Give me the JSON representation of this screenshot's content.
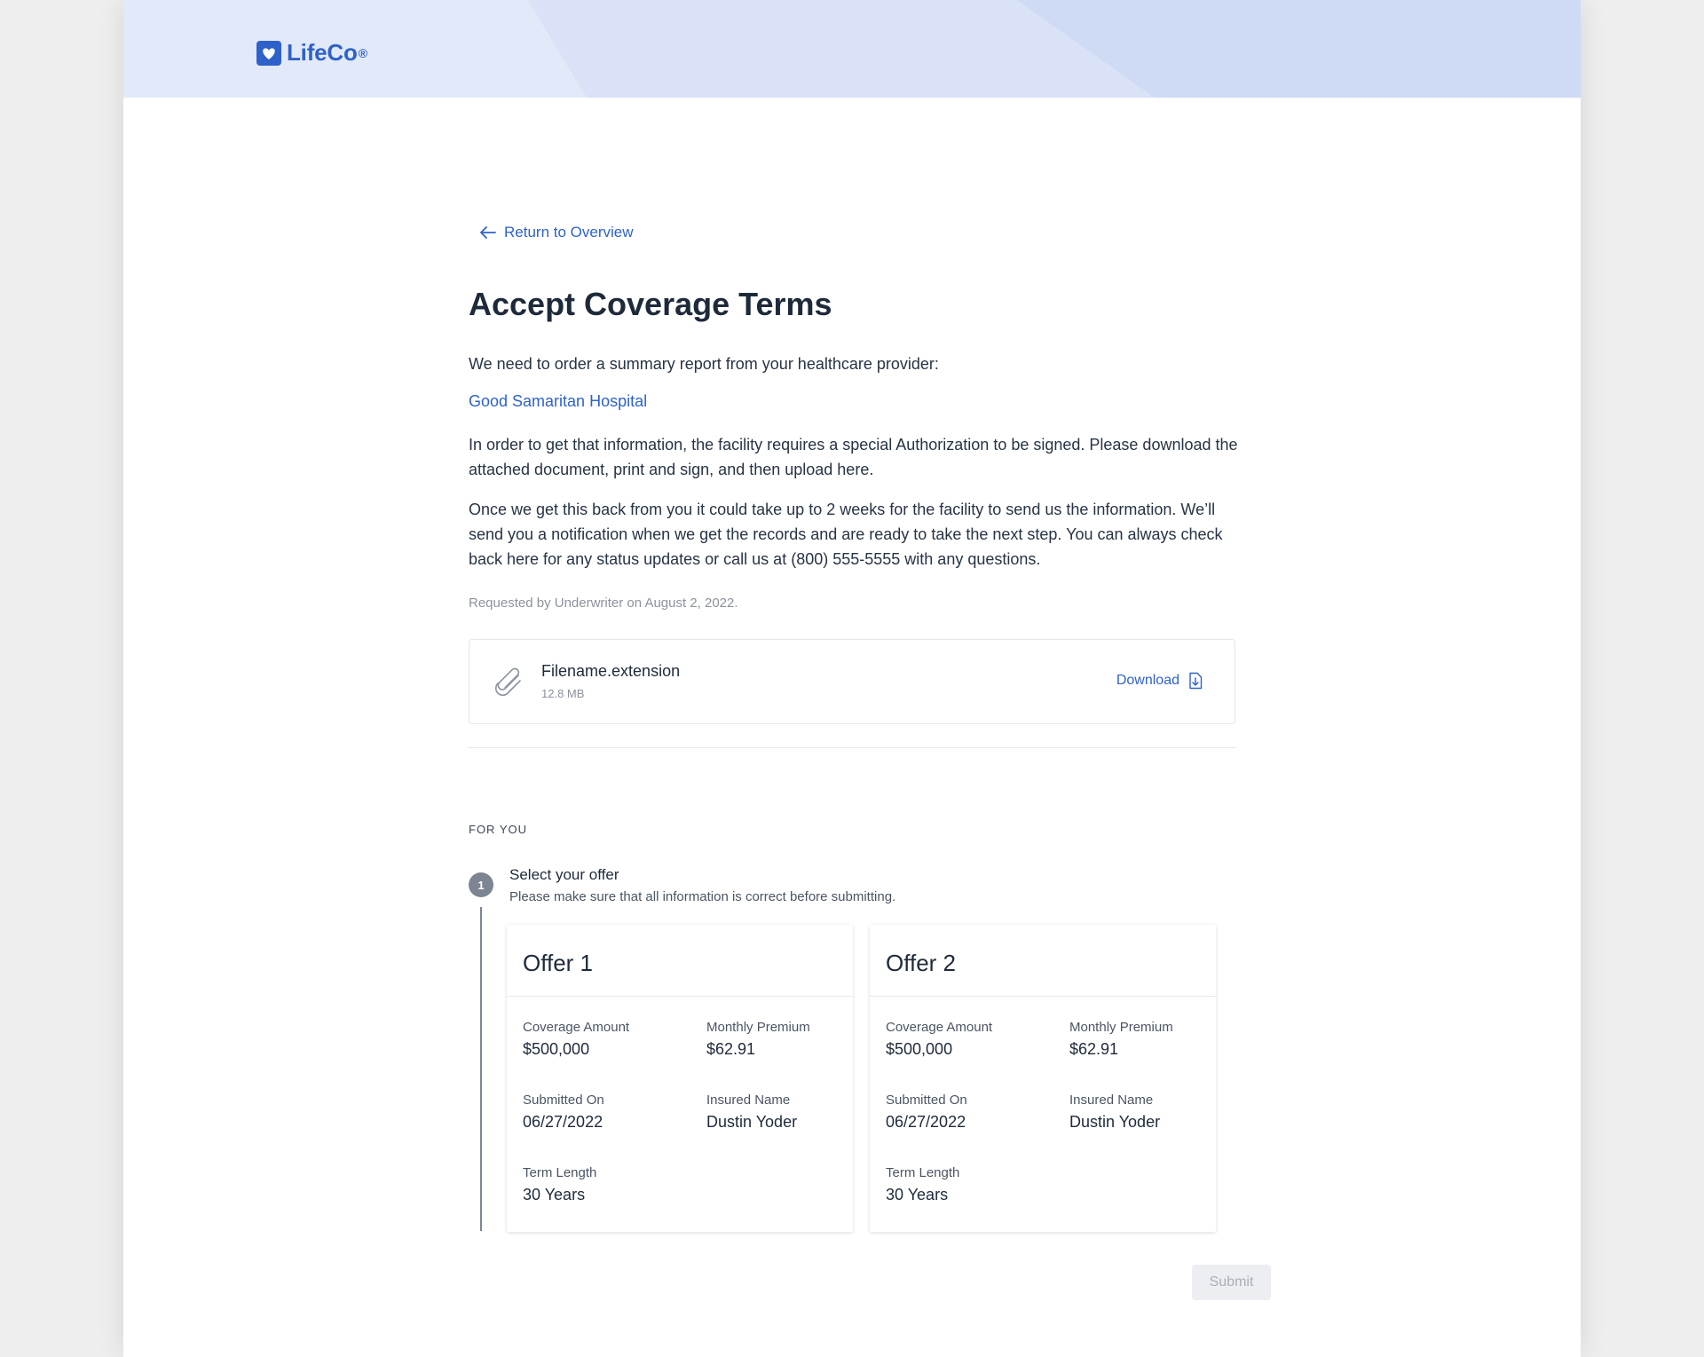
{
  "brand": {
    "name": "LifeCo",
    "registered_mark": "®",
    "color": "#2f62c9"
  },
  "nav": {
    "back_label": "Return to Overview"
  },
  "page": {
    "title": "Accept Coverage Terms",
    "intro": "We need to order a summary report from your healthcare provider:",
    "provider_name": "Good Samaritan Hospital",
    "authorization_text": "In order to get that information, the facility requires a special Authorization to be signed. Please download the attached document, print and sign, and then upload here.",
    "timeline_text": "Once we get this back from you it could take up to 2 weeks for the facility to send us the information. We’ll send you a notification when we get the records and are ready to take the next step. You can always check back here for any status updates or call us at (800) 555-5555 with any questions.",
    "requested_text": "Requested by Underwriter on August 2, 2022."
  },
  "attachment": {
    "filename": "Filename.extension",
    "size": "12.8 MB",
    "download_label": "Download"
  },
  "for_you": {
    "section_label": "FOR YOU",
    "step": {
      "number": "1",
      "title": "Select your offer",
      "subtitle": "Please make sure that all information is correct before submitting."
    },
    "offers": [
      {
        "title": "Offer 1",
        "coverage_label": "Coverage Amount",
        "coverage_value": "$500,000",
        "premium_label": "Monthly Premium",
        "premium_value": "$62.91",
        "submitted_label": "Submitted On",
        "submitted_value": "06/27/2022",
        "insured_label": "Insured Name",
        "insured_value": "Dustin Yoder",
        "term_label": "Term Length",
        "term_value": "30 Years"
      },
      {
        "title": "Offer 2",
        "coverage_label": "Coverage Amount",
        "coverage_value": "$500,000",
        "premium_label": "Monthly Premium",
        "premium_value": "$62.91",
        "submitted_label": "Submitted On",
        "submitted_value": "06/27/2022",
        "insured_label": "Insured Name",
        "insured_value": "Dustin Yoder",
        "term_label": "Term Length",
        "term_value": "30 Years"
      }
    ]
  },
  "actions": {
    "submit_label": "Submit"
  },
  "icons": {
    "logo": "heart-badge-icon",
    "back": "arrow-left-icon",
    "attachment": "paperclip-icon",
    "download": "file-download-icon"
  }
}
